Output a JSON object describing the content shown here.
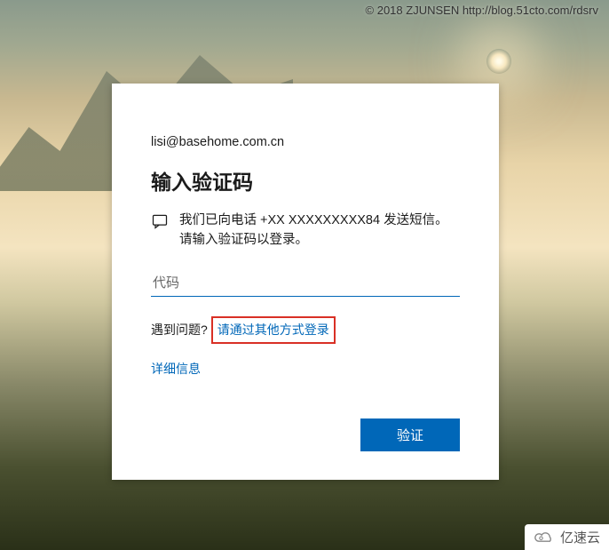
{
  "watermark": "© 2018 ZJUNSEN http://blog.51cto.com/rdsrv",
  "card": {
    "email": "lisi@basehome.com.cn",
    "title": "输入验证码",
    "message": "我们已向电话 +XX XXXXXXXXX84 发送短信。请输入验证码以登录。",
    "input_placeholder": "代码",
    "trouble_label": "遇到问题?",
    "other_methods_link": "请通过其他方式登录",
    "details_link": "详细信息",
    "verify_button": "验证"
  },
  "footer_logo": "亿速云"
}
